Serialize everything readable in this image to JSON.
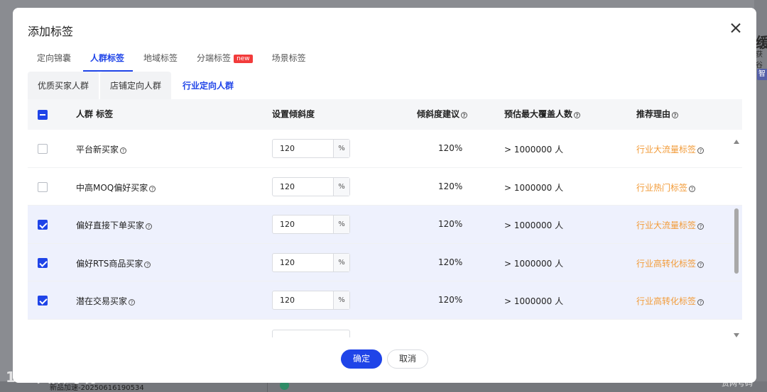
{
  "background": {
    "right_title": "缓",
    "right_sub": "获谷",
    "right_badge": "智",
    "bottom_text": "新品加速-20250616190534",
    "watermark": "大数跨境",
    "watermark_right": "赏网号码"
  },
  "modal": {
    "title": "添加标签",
    "tabs": [
      {
        "label": "定向锦囊"
      },
      {
        "label": "人群标签"
      },
      {
        "label": "地域标签"
      },
      {
        "label": "分端标签",
        "badge": "new"
      },
      {
        "label": "场景标签"
      }
    ],
    "subtabs": [
      {
        "label": "优质买家人群"
      },
      {
        "label": "店铺定向人群"
      },
      {
        "label": "行业定向人群"
      }
    ],
    "table": {
      "headers": {
        "name": "人群 标签",
        "tilt": "设置倾斜度",
        "suggest": "倾斜度建议",
        "cover": "预估最大覆盖人数",
        "reason": "推荐理由"
      },
      "rows": [
        {
          "name": "平台新买家",
          "tilt": "120",
          "unit": "%",
          "suggest": "120%",
          "cover": "> 1000000 人",
          "reason": "行业大流量标签",
          "checked": false
        },
        {
          "name": "中高MOQ偏好买家",
          "tilt": "120",
          "unit": "%",
          "suggest": "120%",
          "cover": "> 1000000 人",
          "reason": "行业热门标签",
          "checked": false
        },
        {
          "name": "偏好直接下单买家",
          "tilt": "120",
          "unit": "%",
          "suggest": "120%",
          "cover": "> 1000000 人",
          "reason": "行业大流量标签",
          "checked": true
        },
        {
          "name": "偏好RTS商品买家",
          "tilt": "120",
          "unit": "%",
          "suggest": "120%",
          "cover": "> 1000000 人",
          "reason": "行业高转化标签",
          "checked": true
        },
        {
          "name": "潜在交易买家",
          "tilt": "120",
          "unit": "%",
          "suggest": "120%",
          "cover": "> 1000000 人",
          "reason": "行业高转化标签",
          "checked": true
        }
      ]
    },
    "footer": {
      "ok": "确定",
      "cancel": "取消"
    },
    "colors": {
      "accent": "#1f44e8",
      "reason": "#f29b38",
      "badge": "#f23b3b"
    }
  }
}
